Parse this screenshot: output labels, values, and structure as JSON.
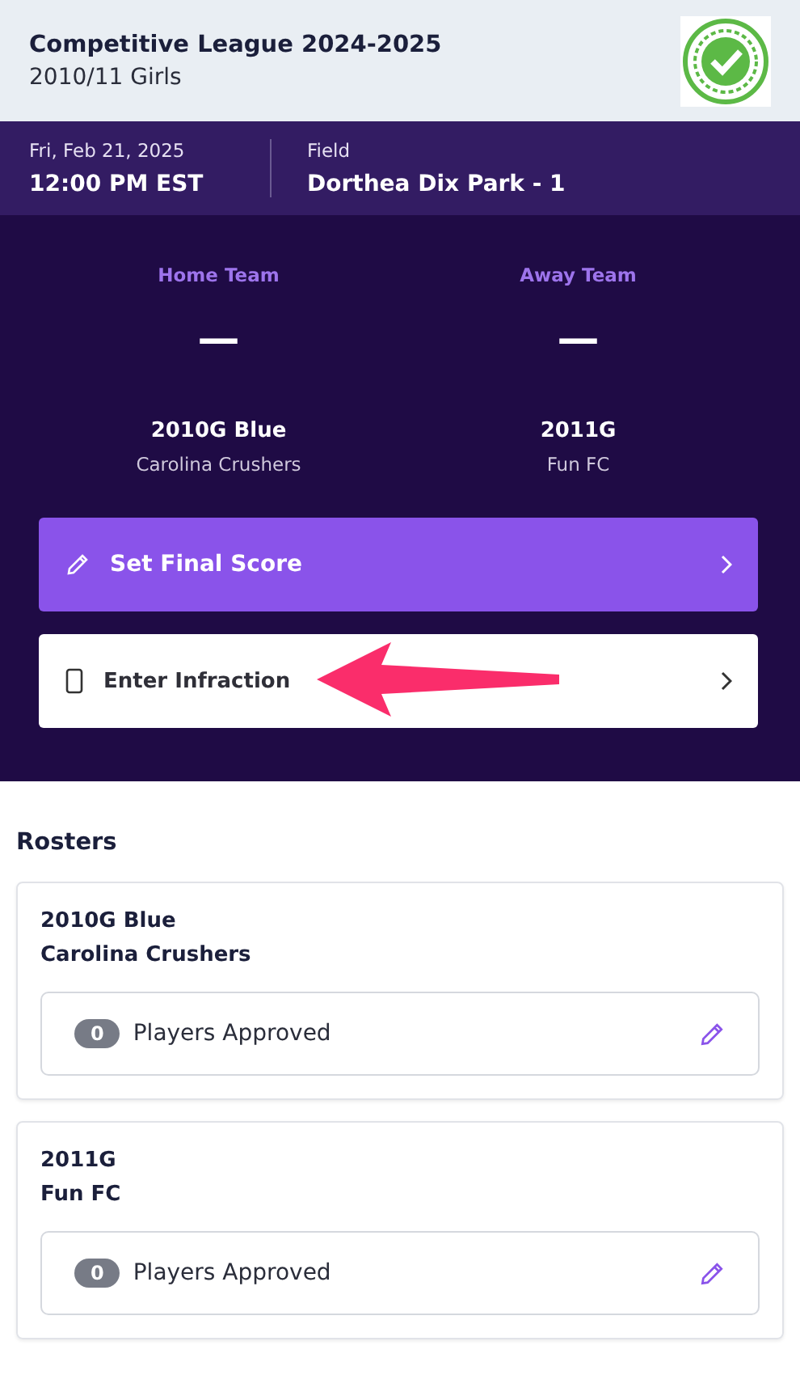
{
  "header": {
    "title": "Competitive League 2024-2025",
    "subtitle": "2010/11 Girls"
  },
  "info_bar": {
    "date": "Fri, Feb 21, 2025",
    "time": "12:00 PM EST",
    "field_label": "Field",
    "field": "Dorthea Dix Park - 1"
  },
  "teams": [
    {
      "role": "Home Team",
      "score": "—",
      "team": "2010G Blue",
      "club": "Carolina Crushers"
    },
    {
      "role": "Away Team",
      "score": "—",
      "team": "2011G",
      "club": "Fun FC"
    }
  ],
  "actions": [
    {
      "kind": "primary",
      "label": "Set Final Score"
    },
    {
      "kind": "secondary",
      "label": "Enter Infraction"
    }
  ],
  "rosters": {
    "title": "Rosters",
    "cards": [
      {
        "team": "2010G Blue",
        "club": "Carolina Crushers",
        "count": "0",
        "label": "Players Approved"
      },
      {
        "team": "2011G",
        "club": "Fun FC",
        "count": "0",
        "label": "Players Approved"
      }
    ]
  }
}
